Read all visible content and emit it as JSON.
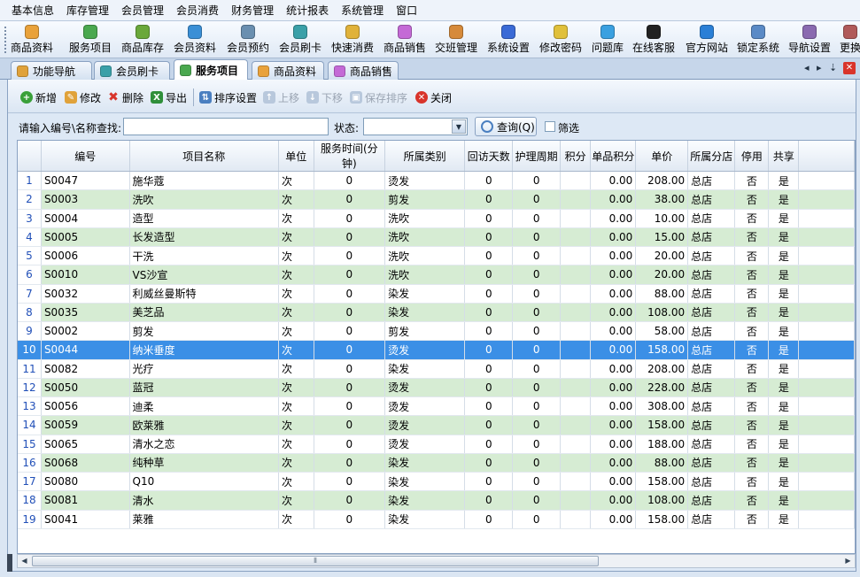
{
  "menubar": [
    "基本信息",
    "库存管理",
    "会员管理",
    "会员消费",
    "财务管理",
    "统计报表",
    "系统管理",
    "窗口"
  ],
  "toolbar": [
    {
      "label": "商品资料",
      "icon": "product-icon",
      "color": "#e9a23b"
    },
    {
      "label": "服务项目",
      "icon": "service-icon",
      "color": "#4aa84f"
    },
    {
      "label": "商品库存",
      "icon": "inventory-icon",
      "color": "#6aa83a"
    },
    {
      "label": "会员资料",
      "icon": "member-icon",
      "color": "#3a8fd6"
    },
    {
      "label": "会员预约",
      "icon": "appointment-icon",
      "color": "#6a8fb0"
    },
    {
      "label": "会员刷卡",
      "icon": "card-icon",
      "color": "#3aa0a8"
    },
    {
      "label": "快速消费",
      "icon": "quick-consume-icon",
      "color": "#e0b23a"
    },
    {
      "label": "商品销售",
      "icon": "sales-icon",
      "color": "#c46ad6"
    },
    {
      "label": "交班管理",
      "icon": "shift-icon",
      "color": "#d68a3a"
    },
    {
      "label": "系统设置",
      "icon": "settings-icon",
      "color": "#3a6ad6"
    },
    {
      "label": "修改密码",
      "icon": "password-icon",
      "color": "#e0c03a"
    },
    {
      "label": "问题库",
      "icon": "faq-icon",
      "color": "#3aa0e0"
    },
    {
      "label": "在线客服",
      "icon": "qq-icon",
      "color": "#222222"
    },
    {
      "label": "官方网站",
      "icon": "ie-icon",
      "color": "#2a7fd6"
    },
    {
      "label": "锁定系统",
      "icon": "lock-icon",
      "color": "#5a8ac6"
    },
    {
      "label": "导航设置",
      "icon": "navigation-icon",
      "color": "#8a6ab0"
    },
    {
      "label": "更换",
      "icon": "switch-icon",
      "color": "#b05a5a"
    }
  ],
  "tabs": [
    {
      "label": "功能导航",
      "icon": "home-icon",
      "color": "#e0a23a",
      "active": false
    },
    {
      "label": "会员刷卡",
      "icon": "card-icon",
      "color": "#3aa0a8",
      "active": false
    },
    {
      "label": "服务项目",
      "icon": "service-icon",
      "color": "#4aa84f",
      "active": true
    },
    {
      "label": "商品资料",
      "icon": "product-icon",
      "color": "#e9a23b",
      "active": false
    },
    {
      "label": "商品销售",
      "icon": "sales-icon",
      "color": "#c46ad6",
      "active": false
    }
  ],
  "actions": {
    "add": "新增",
    "edit": "修改",
    "delete": "删除",
    "export": "导出",
    "sort_settings": "排序设置",
    "move_up": "上移",
    "move_down": "下移",
    "save_sort": "保存排序",
    "close": "关闭"
  },
  "search": {
    "label": "请输入编号\\名称查找:",
    "value": "",
    "status_label": "状态:",
    "status_value": "",
    "query_button": "查询(Q)",
    "filter_label": "筛选"
  },
  "table": {
    "columns": [
      "",
      "编号",
      "项目名称",
      "单位",
      "服务时间(分钟)",
      "所属类别",
      "回访天数",
      "护理周期",
      "积分",
      "单品积分",
      "单价",
      "所属分店",
      "停用",
      "共享"
    ],
    "selected_row": 10,
    "rows": [
      [
        "1",
        "S0047",
        "施华蔻",
        "次",
        "0",
        "烫发",
        "0",
        "0",
        "",
        "0.00",
        "208.00",
        "总店",
        "否",
        "是"
      ],
      [
        "2",
        "S0003",
        "洗吹",
        "次",
        "0",
        "剪发",
        "0",
        "0",
        "",
        "0.00",
        "38.00",
        "总店",
        "否",
        "是"
      ],
      [
        "3",
        "S0004",
        "造型",
        "次",
        "0",
        "洗吹",
        "0",
        "0",
        "",
        "0.00",
        "10.00",
        "总店",
        "否",
        "是"
      ],
      [
        "4",
        "S0005",
        "长发造型",
        "次",
        "0",
        "洗吹",
        "0",
        "0",
        "",
        "0.00",
        "15.00",
        "总店",
        "否",
        "是"
      ],
      [
        "5",
        "S0006",
        "干洗",
        "次",
        "0",
        "洗吹",
        "0",
        "0",
        "",
        "0.00",
        "20.00",
        "总店",
        "否",
        "是"
      ],
      [
        "6",
        "S0010",
        "VS沙宣",
        "次",
        "0",
        "洗吹",
        "0",
        "0",
        "",
        "0.00",
        "20.00",
        "总店",
        "否",
        "是"
      ],
      [
        "7",
        "S0032",
        "利威丝曼斯特",
        "次",
        "0",
        "染发",
        "0",
        "0",
        "",
        "0.00",
        "88.00",
        "总店",
        "否",
        "是"
      ],
      [
        "8",
        "S0035",
        "美芝品",
        "次",
        "0",
        "染发",
        "0",
        "0",
        "",
        "0.00",
        "108.00",
        "总店",
        "否",
        "是"
      ],
      [
        "9",
        "S0002",
        "剪发",
        "次",
        "0",
        "剪发",
        "0",
        "0",
        "",
        "0.00",
        "58.00",
        "总店",
        "否",
        "是"
      ],
      [
        "10",
        "S0044",
        "纳米垂度",
        "次",
        "0",
        "烫发",
        "0",
        "0",
        "",
        "0.00",
        "158.00",
        "总店",
        "否",
        "是"
      ],
      [
        "11",
        "S0082",
        "光疗",
        "次",
        "0",
        "染发",
        "0",
        "0",
        "",
        "0.00",
        "208.00",
        "总店",
        "否",
        "是"
      ],
      [
        "12",
        "S0050",
        "蓝冠",
        "次",
        "0",
        "烫发",
        "0",
        "0",
        "",
        "0.00",
        "228.00",
        "总店",
        "否",
        "是"
      ],
      [
        "13",
        "S0056",
        "迪柔",
        "次",
        "0",
        "烫发",
        "0",
        "0",
        "",
        "0.00",
        "308.00",
        "总店",
        "否",
        "是"
      ],
      [
        "14",
        "S0059",
        "欧莱雅",
        "次",
        "0",
        "烫发",
        "0",
        "0",
        "",
        "0.00",
        "158.00",
        "总店",
        "否",
        "是"
      ],
      [
        "15",
        "S0065",
        "清水之恋",
        "次",
        "0",
        "烫发",
        "0",
        "0",
        "",
        "0.00",
        "188.00",
        "总店",
        "否",
        "是"
      ],
      [
        "16",
        "S0068",
        "纯种草",
        "次",
        "0",
        "染发",
        "0",
        "0",
        "",
        "0.00",
        "88.00",
        "总店",
        "否",
        "是"
      ],
      [
        "17",
        "S0080",
        "Q10",
        "次",
        "0",
        "染发",
        "0",
        "0",
        "",
        "0.00",
        "158.00",
        "总店",
        "否",
        "是"
      ],
      [
        "18",
        "S0081",
        "清水",
        "次",
        "0",
        "染发",
        "0",
        "0",
        "",
        "0.00",
        "108.00",
        "总店",
        "否",
        "是"
      ],
      [
        "19",
        "S0041",
        "莱雅",
        "次",
        "0",
        "染发",
        "0",
        "0",
        "",
        "0.00",
        "158.00",
        "总店",
        "否",
        "是"
      ]
    ]
  }
}
